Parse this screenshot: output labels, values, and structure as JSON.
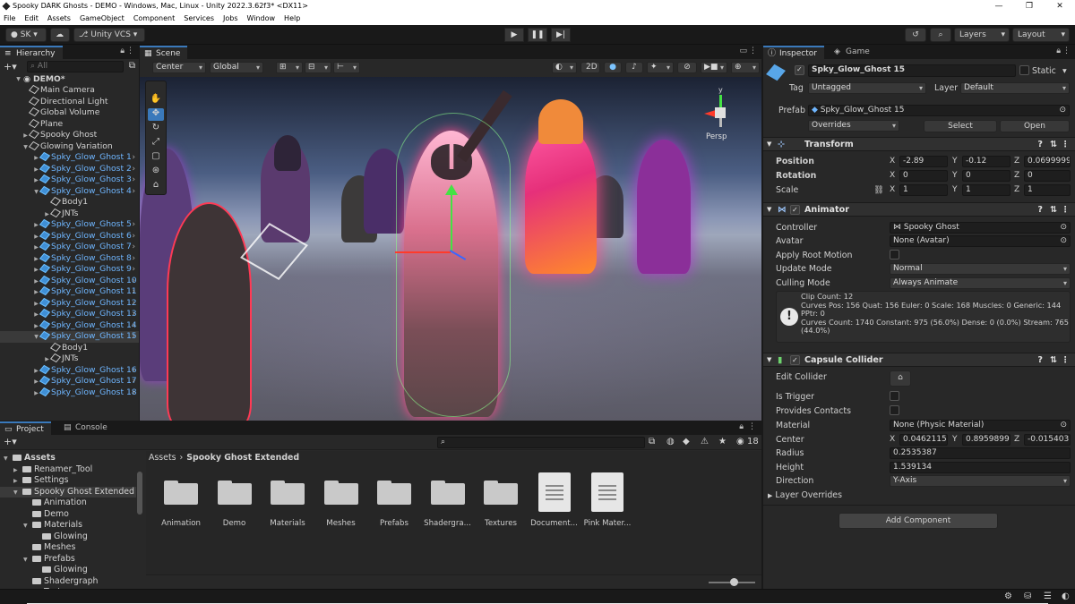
{
  "window": {
    "title": "Spooky DARK Ghosts - DEMO - Windows, Mac, Linux - Unity 2022.3.62f3* <DX11>"
  },
  "menu": [
    "File",
    "Edit",
    "Assets",
    "GameObject",
    "Component",
    "Services",
    "Jobs",
    "Window",
    "Help"
  ],
  "toolbar": {
    "account": "SK",
    "vcs": "Unity VCS",
    "layers": "Layers",
    "layout": "Layout"
  },
  "hierarchy": {
    "tab": "Hierarchy",
    "search_placeholder": "All",
    "scene": "DEMO*",
    "items": [
      {
        "label": "Main Camera",
        "indent": 1,
        "prefab": false,
        "tri": ""
      },
      {
        "label": "Directional Light",
        "indent": 1,
        "prefab": false,
        "tri": ""
      },
      {
        "label": "Global Volume",
        "indent": 1,
        "prefab": false,
        "tri": ""
      },
      {
        "label": "Plane",
        "indent": 1,
        "prefab": false,
        "tri": ""
      },
      {
        "label": "Spooky Ghost",
        "indent": 1,
        "prefab": false,
        "tri": "▶"
      },
      {
        "label": "Glowing Variation",
        "indent": 1,
        "prefab": false,
        "tri": "▼"
      },
      {
        "label": "Spky_Glow_Ghost 1",
        "indent": 2,
        "prefab": true,
        "tri": "▶"
      },
      {
        "label": "Spky_Glow_Ghost 2",
        "indent": 2,
        "prefab": true,
        "tri": "▶"
      },
      {
        "label": "Spky_Glow_Ghost 3",
        "indent": 2,
        "prefab": true,
        "tri": "▶"
      },
      {
        "label": "Spky_Glow_Ghost 4",
        "indent": 2,
        "prefab": true,
        "tri": "▼"
      },
      {
        "label": "Body1",
        "indent": 3,
        "prefab": false,
        "tri": ""
      },
      {
        "label": "JNTs",
        "indent": 3,
        "prefab": false,
        "tri": "▶"
      },
      {
        "label": "Spky_Glow_Ghost 5",
        "indent": 2,
        "prefab": true,
        "tri": "▶"
      },
      {
        "label": "Spky_Glow_Ghost 6",
        "indent": 2,
        "prefab": true,
        "tri": "▶"
      },
      {
        "label": "Spky_Glow_Ghost 7",
        "indent": 2,
        "prefab": true,
        "tri": "▶"
      },
      {
        "label": "Spky_Glow_Ghost 8",
        "indent": 2,
        "prefab": true,
        "tri": "▶"
      },
      {
        "label": "Spky_Glow_Ghost 9",
        "indent": 2,
        "prefab": true,
        "tri": "▶"
      },
      {
        "label": "Spky_Glow_Ghost 10",
        "indent": 2,
        "prefab": true,
        "tri": "▶"
      },
      {
        "label": "Spky_Glow_Ghost 11",
        "indent": 2,
        "prefab": true,
        "tri": "▶"
      },
      {
        "label": "Spky_Glow_Ghost 12",
        "indent": 2,
        "prefab": true,
        "tri": "▶"
      },
      {
        "label": "Spky_Glow_Ghost 13",
        "indent": 2,
        "prefab": true,
        "tri": "▶"
      },
      {
        "label": "Spky_Glow_Ghost 14",
        "indent": 2,
        "prefab": true,
        "tri": "▶"
      },
      {
        "label": "Spky_Glow_Ghost 15",
        "indent": 2,
        "prefab": true,
        "tri": "▼",
        "selected": true
      },
      {
        "label": "Body1",
        "indent": 3,
        "prefab": false,
        "tri": ""
      },
      {
        "label": "JNTs",
        "indent": 3,
        "prefab": false,
        "tri": "▶"
      },
      {
        "label": "Spky_Glow_Ghost 16",
        "indent": 2,
        "prefab": true,
        "tri": "▶"
      },
      {
        "label": "Spky_Glow_Ghost 17",
        "indent": 2,
        "prefab": true,
        "tri": "▶"
      },
      {
        "label": "Spky_Glow_Ghost 18",
        "indent": 2,
        "prefab": true,
        "tri": "▶"
      }
    ]
  },
  "scene": {
    "tab": "Scene",
    "pivot": "Center",
    "space": "Global",
    "mode_2d": "2D",
    "gizmo_label": "Persp"
  },
  "inspector": {
    "tab": "Inspector",
    "game_tab": "Game",
    "object_name": "Spky_Glow_Ghost 15",
    "static_label": "Static",
    "tag_label": "Tag",
    "tag_value": "Untagged",
    "layer_label": "Layer",
    "layer_value": "Default",
    "prefab_label": "Prefab",
    "prefab_value": "Spky_Glow_Ghost 15",
    "overrides": "Overrides",
    "select_btn": "Select",
    "open_btn": "Open",
    "transform": {
      "title": "Transform",
      "position_label": "Position",
      "position": {
        "x": "-2.89",
        "y": "-0.12",
        "z": "0.0699999"
      },
      "rotation_label": "Rotation",
      "rotation": {
        "x": "0",
        "y": "0",
        "z": "0"
      },
      "scale_label": "Scale",
      "scale": {
        "x": "1",
        "y": "1",
        "z": "1"
      }
    },
    "animator": {
      "title": "Animator",
      "controller_label": "Controller",
      "controller": "Spooky Ghost",
      "avatar_label": "Avatar",
      "avatar": "None (Avatar)",
      "root_motion_label": "Apply Root Motion",
      "update_mode_label": "Update Mode",
      "update_mode": "Normal",
      "culling_label": "Culling Mode",
      "culling": "Always Animate",
      "info_line1": "Clip Count: 12",
      "info_line2": "Curves Pos: 156 Quat: 156 Euler: 0 Scale: 168 Muscles: 0 Generic: 144 PPtr: 0",
      "info_line3": "Curves Count: 1740 Constant: 975 (56.0%) Dense: 0 (0.0%) Stream: 765 (44.0%)"
    },
    "collider": {
      "title": "Capsule Collider",
      "edit_label": "Edit Collider",
      "trigger_label": "Is Trigger",
      "contacts_label": "Provides Contacts",
      "material_label": "Material",
      "material": "None (Physic Material)",
      "center_label": "Center",
      "center": {
        "x": "0.0462115",
        "y": "0.8959899",
        "z": "-0.015403"
      },
      "radius_label": "Radius",
      "radius": "0.2535387",
      "height_label": "Height",
      "height": "1.539134",
      "direction_label": "Direction",
      "direction": "Y-Axis",
      "layer_overrides": "Layer Overrides"
    },
    "add_component": "Add Component"
  },
  "project": {
    "tab": "Project",
    "console_tab": "Console",
    "count": "18",
    "tree": [
      {
        "label": "Assets",
        "indent": 0,
        "tri": "▼",
        "bold": true
      },
      {
        "label": "Renamer_Tool",
        "indent": 1,
        "tri": "▶"
      },
      {
        "label": "Settings",
        "indent": 1,
        "tri": "▶"
      },
      {
        "label": "Spooky Ghost Extended",
        "indent": 1,
        "tri": "▼",
        "selected": true
      },
      {
        "label": "Animation",
        "indent": 2,
        "tri": ""
      },
      {
        "label": "Demo",
        "indent": 2,
        "tri": ""
      },
      {
        "label": "Materials",
        "indent": 2,
        "tri": "▼"
      },
      {
        "label": "Glowing",
        "indent": 3,
        "tri": ""
      },
      {
        "label": "Meshes",
        "indent": 2,
        "tri": ""
      },
      {
        "label": "Prefabs",
        "indent": 2,
        "tri": "▼"
      },
      {
        "label": "Glowing",
        "indent": 3,
        "tri": ""
      },
      {
        "label": "Shadergraph",
        "indent": 2,
        "tri": ""
      },
      {
        "label": "Textures",
        "indent": 2,
        "tri": ""
      }
    ],
    "breadcrumb": {
      "root": "Assets",
      "current": "Spooky Ghost Extended"
    },
    "assets": [
      {
        "label": "Animation",
        "kind": "folder"
      },
      {
        "label": "Demo",
        "kind": "folder"
      },
      {
        "label": "Materials",
        "kind": "folder"
      },
      {
        "label": "Meshes",
        "kind": "folder"
      },
      {
        "label": "Prefabs",
        "kind": "folder"
      },
      {
        "label": "Shadergra...",
        "kind": "folder"
      },
      {
        "label": "Textures",
        "kind": "folder"
      },
      {
        "label": "Document...",
        "kind": "doc"
      },
      {
        "label": "Pink Mater...",
        "kind": "doc"
      }
    ]
  }
}
